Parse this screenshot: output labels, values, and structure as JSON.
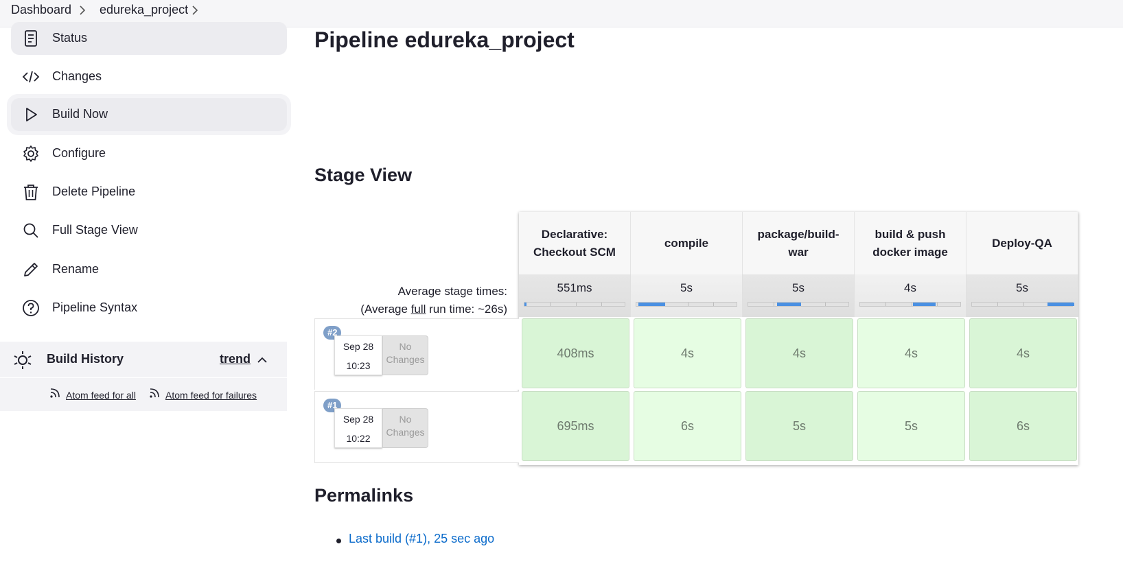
{
  "breadcrumb": [
    {
      "label": "Dashboard"
    },
    {
      "label": "edureka_project"
    }
  ],
  "sidebar": {
    "items": [
      {
        "label": "Status",
        "icon": "document-icon"
      },
      {
        "label": "Changes",
        "icon": "code-icon"
      },
      {
        "label": "Build Now",
        "icon": "play-icon"
      },
      {
        "label": "Configure",
        "icon": "gear-icon"
      },
      {
        "label": "Delete Pipeline",
        "icon": "trash-icon"
      },
      {
        "label": "Full Stage View",
        "icon": "search-icon"
      },
      {
        "label": "Rename",
        "icon": "pencil-icon"
      },
      {
        "label": "Pipeline Syntax",
        "icon": "help-icon"
      }
    ],
    "build_history": {
      "title": "Build History",
      "trend": "trend",
      "feed_all": "Atom feed for all",
      "feed_failures": "Atom feed for failures"
    }
  },
  "main": {
    "title": "Pipeline edureka_project",
    "stage_view_title": "Stage View",
    "avg_label_line1": "Average stage times:",
    "avg_label_prefix": "(Average ",
    "avg_label_full": "full",
    "avg_label_suffix": " run time: ~26s)",
    "stages": [
      {
        "name": "Declarative: Checkout SCM",
        "avg": "551ms",
        "progress_start": 0.0,
        "progress_end": 0.02
      },
      {
        "name": "compile",
        "avg": "5s",
        "progress_start": 0.02,
        "progress_end": 0.28
      },
      {
        "name": "package/build-war",
        "avg": "5s",
        "progress_start": 0.28,
        "progress_end": 0.52
      },
      {
        "name": "build & push docker image",
        "avg": "4s",
        "progress_start": 0.52,
        "progress_end": 0.74
      },
      {
        "name": "Deploy-QA",
        "avg": "5s",
        "progress_start": 0.74,
        "progress_end": 1.0
      }
    ],
    "runs": [
      {
        "badge": "#2",
        "date": "Sep 28",
        "time": "10:23",
        "changes": "No Changes",
        "durations": [
          "408ms",
          "4s",
          "4s",
          "4s",
          "4s"
        ]
      },
      {
        "badge": "#1",
        "date": "Sep 28",
        "time": "10:22",
        "changes": "No Changes",
        "durations": [
          "695ms",
          "6s",
          "5s",
          "5s",
          "6s"
        ]
      }
    ],
    "permalinks_title": "Permalinks",
    "permalinks": [
      "Last build (#1), 25 sec ago"
    ]
  },
  "colors": {
    "accent": "#4a90e2",
    "link": "#0b6bcb",
    "success_cell_dark": "#d9f5d6",
    "success_cell_light": "#e6fde3",
    "badge": "#7f9fc8"
  }
}
